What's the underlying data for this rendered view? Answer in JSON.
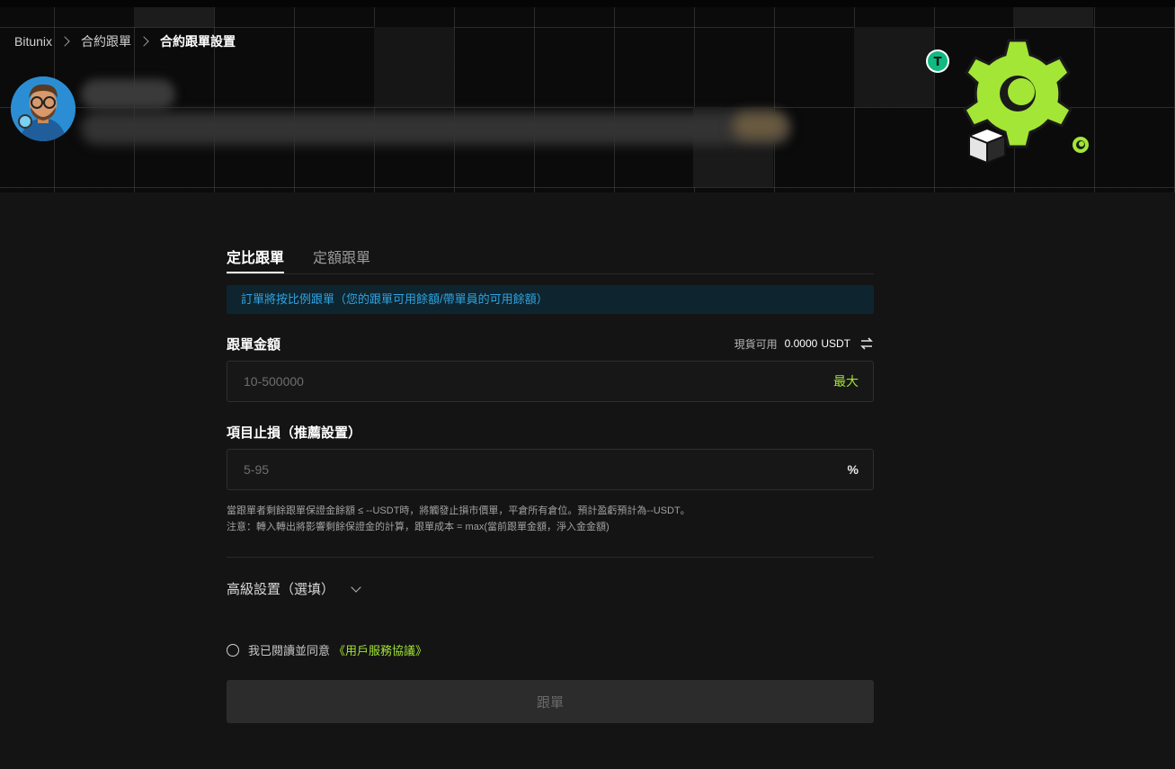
{
  "breadcrumb": {
    "items": [
      "Bitunix",
      "合約跟單",
      "合約跟單設置"
    ]
  },
  "tabs": [
    {
      "label": "定比跟單",
      "active": true
    },
    {
      "label": "定額跟單",
      "active": false
    }
  ],
  "info_banner": "訂單將按比例跟單（您的跟單可用餘額/帶單員的可用餘額）",
  "amount": {
    "label": "跟單金額",
    "balance_label": "現貨可用",
    "balance_value": "0.0000",
    "balance_unit": "USDT",
    "placeholder": "10-500000",
    "max_label": "最大"
  },
  "stop_loss": {
    "label": "項目止損（推薦設置）",
    "placeholder": "5-95",
    "unit": "%"
  },
  "notes": [
    "當跟單者剩餘跟單保證金餘額 ≤ --USDT時，將觸發止損市價單，平倉所有倉位。預計盈虧預計為--USDT。",
    "注意：轉入轉出將影響剩餘保證金的計算，跟單成本 = max(當前跟單金額，淨入金金額)"
  ],
  "advanced": {
    "label": "高級設置（選填）"
  },
  "agreement": {
    "text": "我已閱讀並同意",
    "link": "《用戶服務協議》"
  },
  "submit_label": "跟單",
  "colors": {
    "accent": "#a3e635",
    "info": "#2fa3e0",
    "background": "#141414"
  }
}
